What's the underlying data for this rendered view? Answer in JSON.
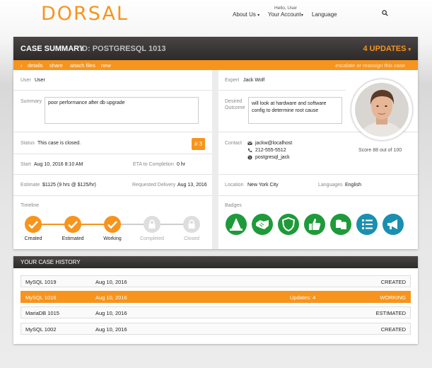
{
  "brand": {
    "logo_text": "DORSAL"
  },
  "nav": {
    "about": "About Us",
    "greeting": "Hello, User",
    "account": "Your Account",
    "language": "Language"
  },
  "case": {
    "title": "CASE SUMMARY",
    "id": "ID: POSTGRESQL 1013",
    "updates": "4 UPDATES",
    "tabs": [
      "details",
      "share",
      "attach files",
      "new"
    ],
    "escalate": "escalate or reassign this case",
    "user_label": "User",
    "user_value": "User",
    "summary_label": "Summary",
    "summary_value": "poor performance after db upgrade",
    "status_label": "Status",
    "status_value": "This case is closed.",
    "case_badge": "# 3",
    "start_label": "Start",
    "start_value": "Aug 10, 2016 8:10 AM",
    "eta_label": "ETA to Completion",
    "eta_value": "0 hr",
    "estimate_label": "Estimate",
    "estimate_value": "$1125 (9 hrs @ $125/hr)",
    "delivery_label": "Requested Delivery",
    "delivery_value": "Aug 13, 2016",
    "timeline_label": "Timeline",
    "timeline": [
      {
        "label": "Created",
        "done": true
      },
      {
        "label": "Estimated",
        "done": true
      },
      {
        "label": "Working",
        "done": true
      },
      {
        "label": "Completed",
        "done": false
      },
      {
        "label": "Closed",
        "done": false
      }
    ],
    "expert_label": "Expert",
    "expert_value": "Jack Wolf",
    "outcome_label_1": "Desired",
    "outcome_label_2": "Outcome",
    "outcome_value": "will look at hardware and software config to determine root cause",
    "contact_label": "Contact",
    "contact_email": "jackw@localhost",
    "contact_phone": "212-555-5512",
    "contact_skype": "postgresql_jack",
    "score_text": "Score  88 out of 100",
    "location_label": "Location",
    "location_value": "New York City",
    "languages_label": "Languages",
    "languages_value": "English",
    "badges_label": "Badges",
    "badge_colors": [
      "#1f9a3a",
      "#1f9a3a",
      "#1f9a3a",
      "#1f9a3a",
      "#1f9a3a",
      "#1a8fb0",
      "#1a8fb0"
    ]
  },
  "history": {
    "title": "YOUR CASE HISTORY",
    "rows": [
      {
        "name": "MySQL 1019",
        "date": "Aug 10, 2016",
        "updates": "",
        "status": "CREATED",
        "active": false
      },
      {
        "name": "MySQL 1016",
        "date": "Aug 10, 2016",
        "updates": "Updates: 4",
        "status": "WORKING",
        "active": true
      },
      {
        "name": "MariaDB 1015",
        "date": "Aug 10, 2016",
        "updates": "",
        "status": "ESTIMATED",
        "active": false
      },
      {
        "name": "MySQL 1002",
        "date": "Aug 10, 2016",
        "updates": "",
        "status": "CREATED",
        "active": false
      }
    ]
  },
  "colors": {
    "accent": "#f7941d",
    "header_dark": "#2e2a2a",
    "badge_green": "#1f9a3a",
    "badge_teal": "#1a8fb0"
  }
}
